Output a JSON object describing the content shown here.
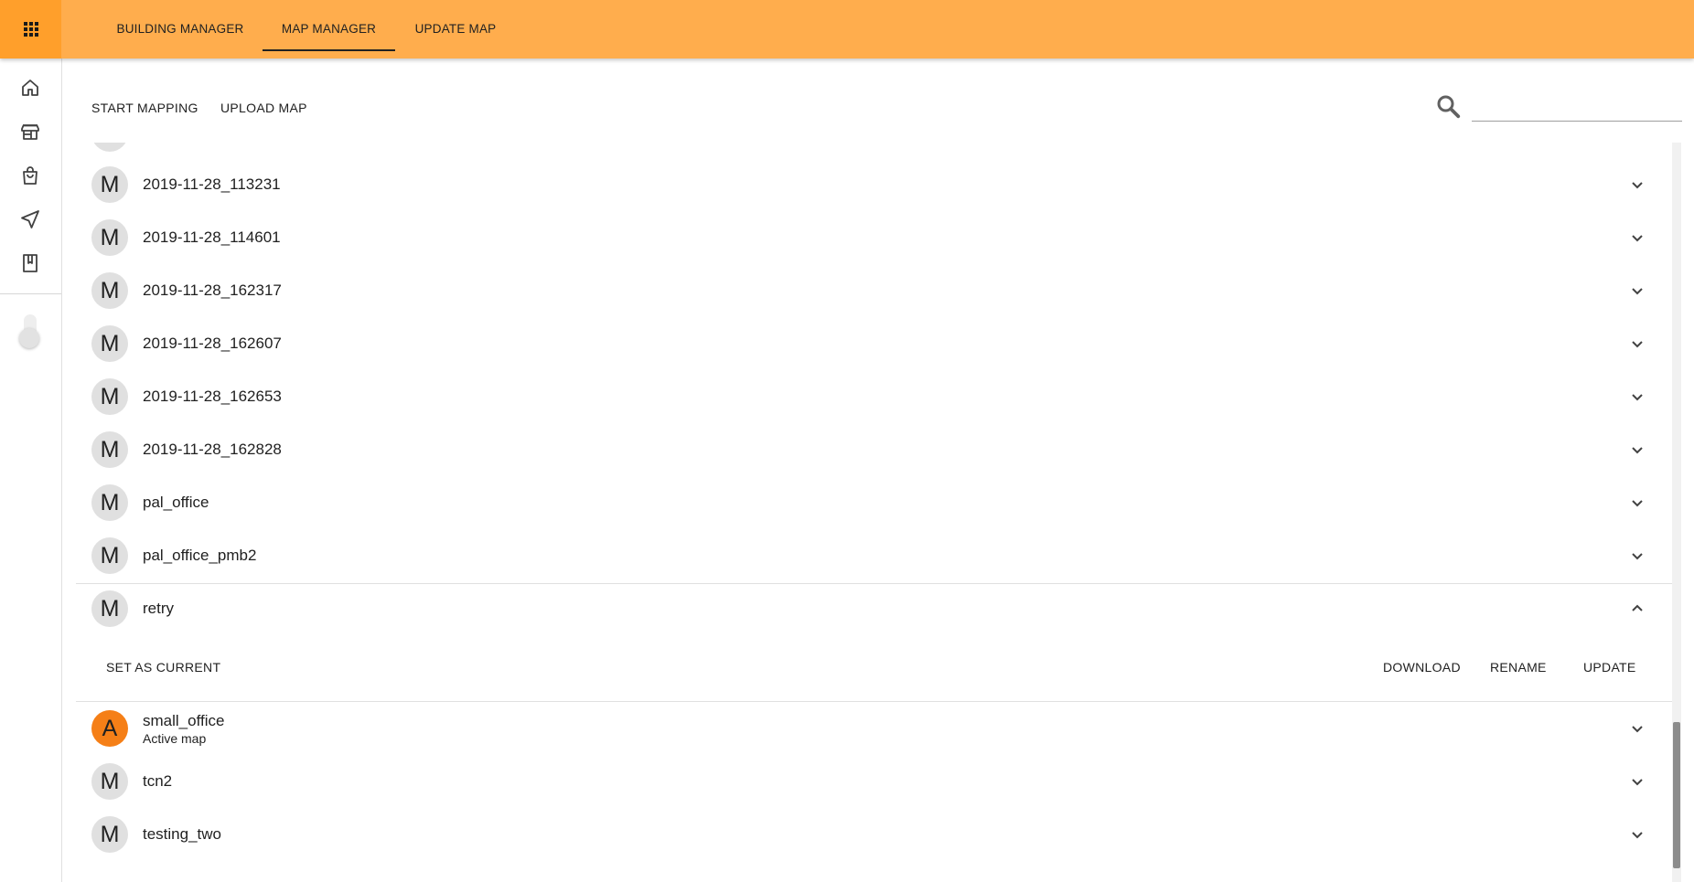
{
  "nav": {
    "tabs": [
      "BUILDING MANAGER",
      "MAP MANAGER",
      "UPDATE MAP"
    ],
    "active_tab": "MAP MANAGER"
  },
  "sidebar": {
    "icons": [
      "home-icon",
      "store-icon",
      "shopping-bag-icon",
      "navigation-arrow-icon",
      "bookmark-icon"
    ]
  },
  "toolbar": {
    "start_mapping": "START MAPPING",
    "upload_map": "UPLOAD MAP",
    "search_value": "",
    "search_icon": "search-icon"
  },
  "maps": [
    {
      "avatar": "M",
      "name": "2019-11-28_113231"
    },
    {
      "avatar": "M",
      "name": "2019-11-28_114601"
    },
    {
      "avatar": "M",
      "name": "2019-11-28_162317"
    },
    {
      "avatar": "M",
      "name": "2019-11-28_162607"
    },
    {
      "avatar": "M",
      "name": "2019-11-28_162653"
    },
    {
      "avatar": "M",
      "name": "2019-11-28_162828"
    },
    {
      "avatar": "M",
      "name": "pal_office"
    },
    {
      "avatar": "M",
      "name": "pal_office_pmb2"
    },
    {
      "avatar": "M",
      "name": "retry",
      "expanded": true
    },
    {
      "avatar": "A",
      "name": "small_office",
      "subtitle": "Active map",
      "active": true
    },
    {
      "avatar": "M",
      "name": "tcn2"
    },
    {
      "avatar": "M",
      "name": "testing_two"
    }
  ],
  "expanded_actions": {
    "set_as_current": "SET AS CURRENT",
    "download": "DOWNLOAD",
    "rename": "RENAME",
    "update": "UPDATE"
  },
  "colors": {
    "header": "#ffad4d",
    "apps_button": "#ff9f2b",
    "active_avatar": "#f57f17",
    "avatar": "#e0e0e0"
  }
}
